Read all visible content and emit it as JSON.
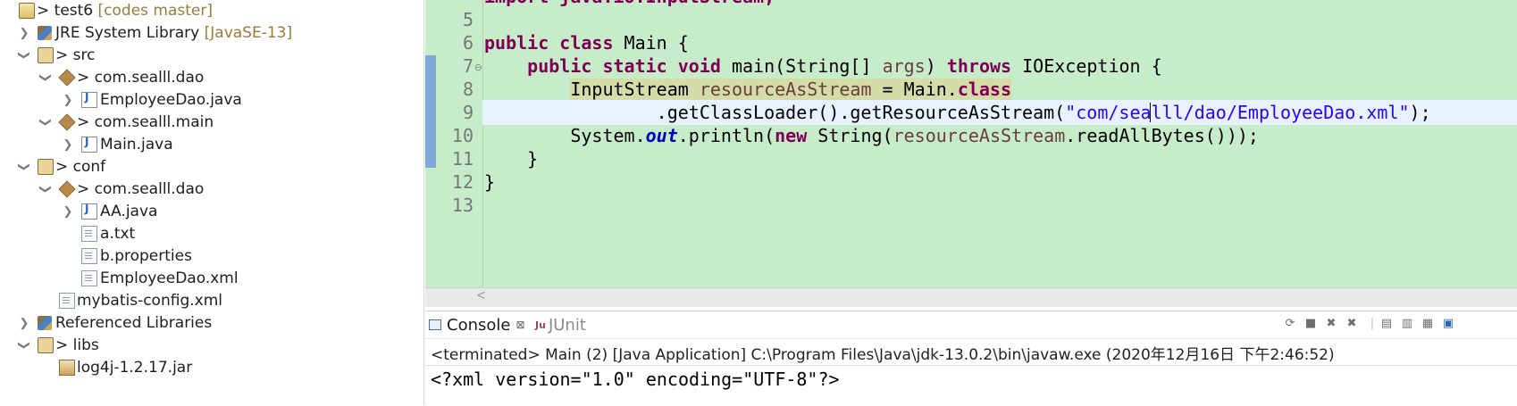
{
  "explorer": {
    "items": [
      {
        "label": "test6",
        "decoration": "[codes master]",
        "prefix": ">",
        "icon": "project-icon"
      },
      {
        "label": "JRE System Library",
        "decoration": "[JavaSE-13]",
        "prefix": "",
        "icon": "library-icon"
      },
      {
        "label": "src",
        "decoration": "",
        "prefix": ">",
        "icon": "source-folder-icon"
      },
      {
        "label": "com.sealll.dao",
        "decoration": "",
        "prefix": ">",
        "icon": "package-icon"
      },
      {
        "label": "EmployeeDao.java",
        "decoration": "",
        "prefix": "",
        "icon": "java-file-icon"
      },
      {
        "label": "com.sealll.main",
        "decoration": "",
        "prefix": ">",
        "icon": "package-icon"
      },
      {
        "label": "Main.java",
        "decoration": "",
        "prefix": "",
        "icon": "java-file-icon"
      },
      {
        "label": "conf",
        "decoration": "",
        "prefix": ">",
        "icon": "source-folder-icon"
      },
      {
        "label": "com.sealll.dao",
        "decoration": "",
        "prefix": ">",
        "icon": "package-icon"
      },
      {
        "label": "AA.java",
        "decoration": "",
        "prefix": "",
        "icon": "java-file-icon"
      },
      {
        "label": "a.txt",
        "decoration": "",
        "prefix": "",
        "icon": "text-file-icon"
      },
      {
        "label": "b.properties",
        "decoration": "",
        "prefix": "",
        "icon": "text-file-icon"
      },
      {
        "label": "EmployeeDao.xml",
        "decoration": "",
        "prefix": "",
        "icon": "xml-file-icon"
      },
      {
        "label": "mybatis-config.xml",
        "decoration": "",
        "prefix": "",
        "icon": "xml-file-icon"
      },
      {
        "label": "Referenced Libraries",
        "decoration": "",
        "prefix": "",
        "icon": "library-icon"
      },
      {
        "label": "libs",
        "decoration": "",
        "prefix": ">",
        "icon": "folder-icon"
      },
      {
        "label": "log4j-1.2.17.jar",
        "decoration": "",
        "prefix": "",
        "icon": "jar-file-icon"
      }
    ]
  },
  "editor": {
    "line_numbers": [
      "5",
      "6",
      "7",
      "8",
      "9",
      "10",
      "11",
      "12",
      "13"
    ],
    "partial_top_line": "import java.io.InputStream;",
    "lines": {
      "l5": "",
      "l6": {
        "kw1": "public",
        "kw2": "class",
        "rest": " Main {"
      },
      "l7": {
        "kw1": "public",
        "kw2": "static",
        "kw3": "void",
        "mid": " main(String[] ",
        "var": "args",
        "mid2": ") ",
        "kw4": "throws",
        "rest": " IOException {"
      },
      "l8": {
        "pre": "InputStream ",
        "var": "resourceAsStream",
        "mid": " = Main.",
        "kw": "class"
      },
      "l9": {
        "pre": ".getClassLoader().getResourceAsStream(",
        "str": "\"com/sealll/dao/EmployeeDao.xml\"",
        "rest": ");"
      },
      "l10": {
        "pre": "System.",
        "field": "out",
        "mid": ".println(",
        "kw": "new",
        "mid2": " String(",
        "var": "resourceAsStream",
        "rest": ".readAllBytes()));"
      },
      "l11": "}",
      "l12": "}",
      "l13": ""
    },
    "scroll_left_glyph": "<"
  },
  "console": {
    "tabs": [
      {
        "label": "Console",
        "close": "⊠"
      },
      {
        "label": "JUnit"
      }
    ],
    "status": "<terminated> Main (2) [Java Application] C:\\Program Files\\Java\\jdk-13.0.2\\bin\\javaw.exe (2020年12月16日 下午2:46:52)",
    "output": "<?xml version=\"1.0\" encoding=\"UTF-8\"?>"
  },
  "colors": {
    "editor_bg": "#c7ecc9",
    "keyword": "#7f0055",
    "string": "#2a00ff",
    "local_var": "#6a3e3e",
    "static_field": "#0000c0",
    "current_line": "#e8f2fe",
    "occurrence_highlight": "#d4dca8"
  }
}
